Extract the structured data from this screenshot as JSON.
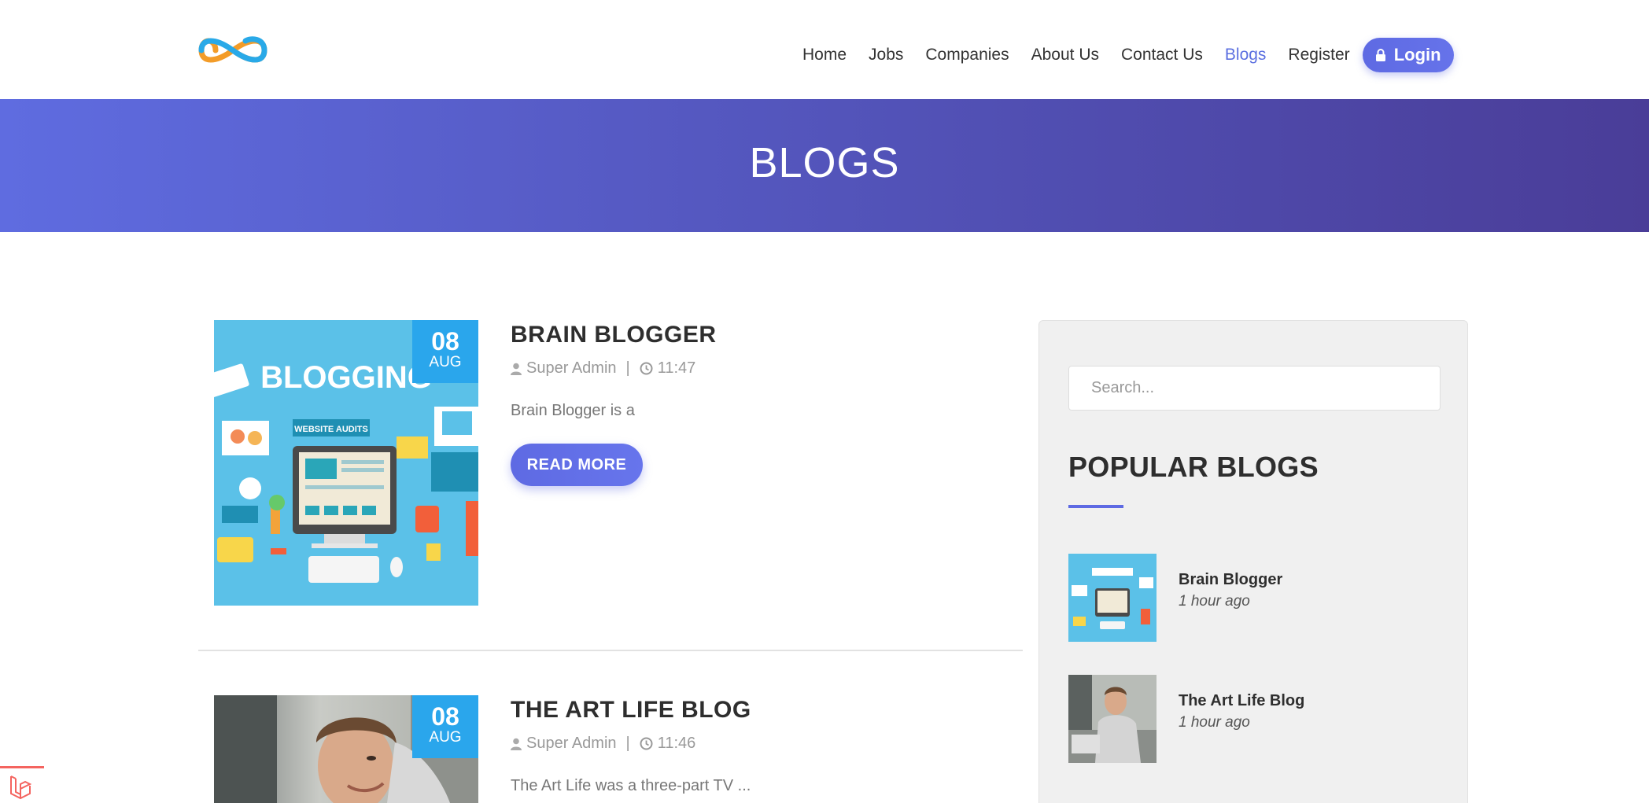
{
  "nav": {
    "items": [
      {
        "label": "Home"
      },
      {
        "label": "Jobs"
      },
      {
        "label": "Companies"
      },
      {
        "label": "About Us"
      },
      {
        "label": "Contact Us"
      },
      {
        "label": "Blogs"
      },
      {
        "label": "Register"
      }
    ],
    "active": "Blogs",
    "login_label": "Login"
  },
  "banner": {
    "title": "BLOGS"
  },
  "posts": [
    {
      "title": "BRAIN BLOGGER",
      "day": "08",
      "month": "AUG",
      "author": "Super Admin",
      "time": "11:47",
      "excerpt": "Brain Blogger is a",
      "read_more": "READ MORE",
      "image_text": "BLOGGING",
      "image_subtext": "WEBSITE AUDITS"
    },
    {
      "title": "THE ART LIFE BLOG",
      "day": "08",
      "month": "AUG",
      "author": "Super Admin",
      "time": "11:46",
      "excerpt": "The Art Life was a three-part TV ..."
    }
  ],
  "sidebar": {
    "search_placeholder": "Search...",
    "popular_title": "POPULAR BLOGS",
    "popular": [
      {
        "title": "Brain Blogger",
        "time": "1 hour ago"
      },
      {
        "title": "The Art Life Blog",
        "time": "1 hour ago"
      }
    ]
  },
  "colors": {
    "accent": "#5e6ae3",
    "badge": "#2aa6ec",
    "banner_start": "#5f6ce0",
    "banner_end": "#4a3d98"
  }
}
